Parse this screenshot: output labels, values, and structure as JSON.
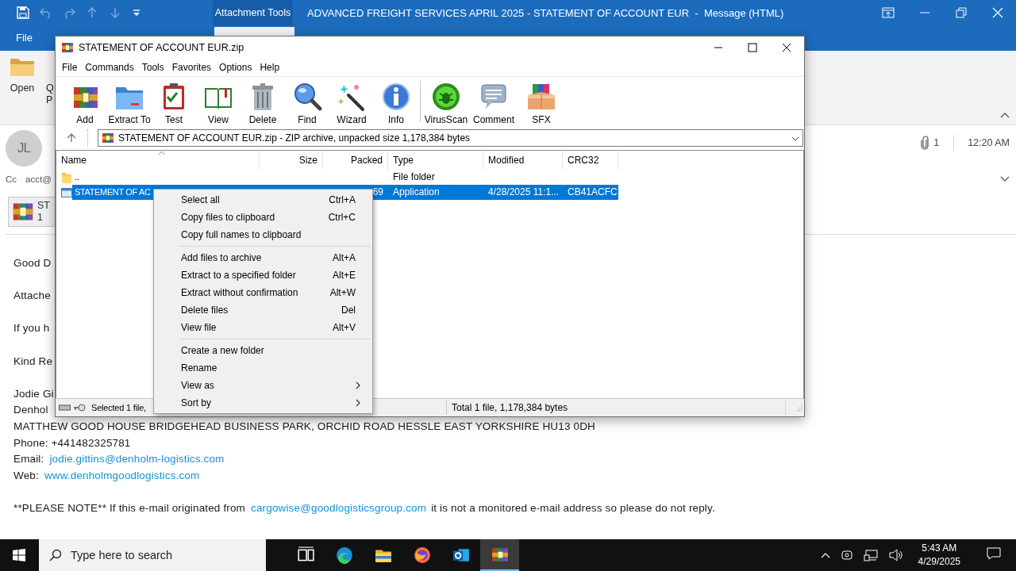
{
  "outlook": {
    "title": "ADVANCED FREIGHT SERVICES APRIL 2025 - STATEMENT OF ACCOUNT EUR  -  Message (HTML)",
    "contextual_tab": "Attachment Tools",
    "ribbon_tabs": [
      {
        "label": "File",
        "selected": false
      }
    ],
    "ribbon_buttons": [
      {
        "kind": "open",
        "lines": [
          "Open"
        ]
      },
      {
        "kind": "partial",
        "lines": [
          "Q",
          "P"
        ]
      }
    ],
    "sender": {
      "initials": "JL"
    },
    "attachment_count": "1",
    "time": "12:20 AM",
    "cc_label": "Cc",
    "cc": "acct@",
    "attachment": {
      "name": "ST",
      "size": "1"
    },
    "body": [
      [
        [
          {
            "text": "Good D"
          }
        ]
      ],
      [
        [
          {
            "text": "Attache"
          }
        ]
      ],
      [
        [
          {
            "text": "If you h"
          }
        ]
      ],
      [
        [
          {
            "text": "Kind Re"
          }
        ]
      ],
      [
        [
          {
            "text": "Jodie Gi"
          }
        ],
        [
          {
            "text": "Denhol"
          }
        ],
        [
          {
            "text": "MATTHEW GOOD HOUSE BRIDGEHEAD BUSINESS PARK, ORCHID ROAD HESSLE EAST YORKSHIRE HU13 0DH"
          }
        ],
        [
          {
            "text": "Phone: +441482325781"
          }
        ],
        [
          {
            "text": "Email:"
          },
          {
            "text": "jodie.gittins@denholm-logistics.com",
            "link": true
          }
        ],
        [
          {
            "text": "Web:"
          },
          {
            "text": "www.denholmgoodlogistics.com",
            "link": true
          }
        ]
      ],
      [
        [
          {
            "text": "**PLEASE NOTE** If this e-mail originated from"
          },
          {
            "text": "cargowise@goodlogisticsgroup.com",
            "link": true
          },
          {
            "text": "it is not a monitored e-mail address so please do not reply."
          }
        ]
      ]
    ]
  },
  "winrar": {
    "title": "STATEMENT OF ACCOUNT EUR.zip",
    "menu": [
      "File",
      "Commands",
      "Tools",
      "Favorites",
      "Options",
      "Help"
    ],
    "toolbar": [
      [
        {
          "kind": "add",
          "label": "Add"
        },
        {
          "kind": "extract",
          "label": "Extract To"
        },
        {
          "kind": "test",
          "label": "Test"
        },
        {
          "kind": "view",
          "label": "View"
        },
        {
          "kind": "delete",
          "label": "Delete"
        },
        {
          "kind": "find",
          "label": "Find"
        },
        {
          "kind": "wizard",
          "label": "Wizard"
        },
        {
          "kind": "info",
          "label": "Info"
        }
      ],
      [
        {
          "kind": "virusscan",
          "label": "VirusScan"
        },
        {
          "kind": "comment",
          "label": "Comment"
        },
        {
          "kind": "sfx",
          "label": "SFX"
        }
      ]
    ],
    "path": "STATEMENT OF ACCOUNT EUR.zip - ZIP archive, unpacked size 1,178,384 bytes",
    "columns": [
      {
        "label": "Name",
        "sorted": true
      },
      {
        "label": "Size",
        "sorted": false
      },
      {
        "label": "Packed",
        "sorted": false
      },
      {
        "label": "Type",
        "sorted": false
      },
      {
        "label": "Modified",
        "sorted": false
      },
      {
        "label": "CRC32",
        "sorted": false
      }
    ],
    "rows": [
      {
        "kind": "folder",
        "selected": false,
        "name": "..",
        "type": "File folder"
      },
      {
        "kind": "file",
        "selected": true,
        "name": "STATEMENT OF AC",
        "packed": "69",
        "type": "Application",
        "modified": "4/28/2025 11:1...",
        "crc32": "CB41ACFC"
      }
    ],
    "status_left": "Selected 1 file,",
    "status_right": "Total 1 file, 1,178,384 bytes"
  },
  "context_menu": {
    "groups": [
      [
        {
          "label": "Select all",
          "shortcut": "Ctrl+A",
          "submenu": false
        },
        {
          "label": "Copy files to clipboard",
          "shortcut": "Ctrl+C",
          "submenu": false
        },
        {
          "label": "Copy full names to clipboard",
          "submenu": false
        }
      ],
      [
        {
          "label": "Add files to archive",
          "shortcut": "Alt+A",
          "submenu": false
        },
        {
          "label": "Extract to a specified folder",
          "shortcut": "Alt+E",
          "submenu": false
        },
        {
          "label": "Extract without confirmation",
          "shortcut": "Alt+W",
          "submenu": false
        },
        {
          "label": "Delete files",
          "shortcut": "Del",
          "submenu": false
        },
        {
          "label": "View file",
          "shortcut": "Alt+V",
          "submenu": false
        }
      ],
      [
        {
          "label": "Create a new folder",
          "submenu": false
        },
        {
          "label": "Rename",
          "submenu": false
        },
        {
          "label": "View as",
          "submenu": true
        },
        {
          "label": "Sort by",
          "submenu": true
        }
      ]
    ]
  },
  "taskbar": {
    "placeholder": "Type here to search",
    "apps": [
      {
        "kind": "task-view",
        "active": false
      },
      {
        "kind": "edge",
        "active": false
      },
      {
        "kind": "explorer",
        "active": false
      },
      {
        "kind": "firefox",
        "active": false
      },
      {
        "kind": "outlook",
        "active": false
      },
      {
        "kind": "winrar",
        "active": true
      }
    ],
    "time": "5:43 AM",
    "date": "4/29/2025"
  }
}
